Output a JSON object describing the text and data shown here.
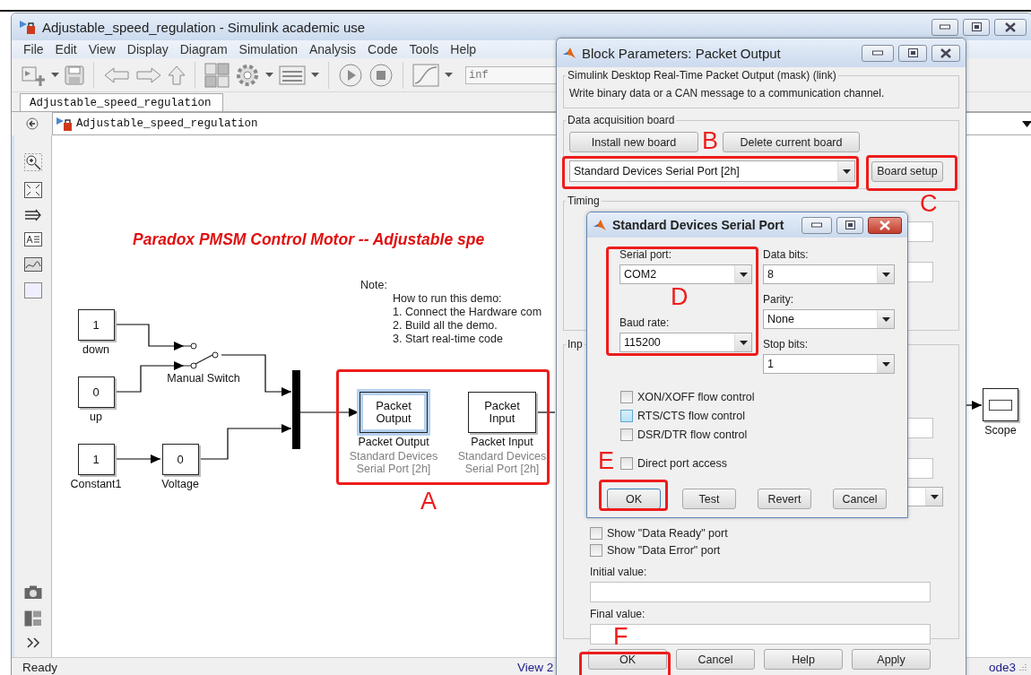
{
  "window": {
    "title": "Adjustable_speed_regulation - Simulink academic use"
  },
  "menu": [
    "File",
    "Edit",
    "View",
    "Display",
    "Diagram",
    "Simulation",
    "Analysis",
    "Code",
    "Tools",
    "Help"
  ],
  "toolbar": {
    "stop_time": "inf"
  },
  "tabs": [
    {
      "label": "Adjustable_speed_regulation",
      "selected": true
    }
  ],
  "breadcrumb": {
    "label": "Adjustable_speed_regulation"
  },
  "diagram": {
    "title": "Paradox PMSM Control Motor  -- Adjustable spe",
    "note": {
      "heading": "Note:",
      "lines": [
        "How to run this demo:",
        "1.  Connect the Hardware com",
        "2.  Build all the demo.",
        "3.  Start real-time code"
      ]
    },
    "blocks": [
      {
        "kind": "constant",
        "value": "1",
        "label": "down"
      },
      {
        "kind": "switch",
        "label": "Manual Switch"
      },
      {
        "kind": "constant",
        "value": "0",
        "label": "up"
      },
      {
        "kind": "mux"
      },
      {
        "kind": "packet",
        "text": "Packet Output",
        "label": "Packet Output",
        "detail": "Standard Devices Serial Port [2h]",
        "selected": true
      },
      {
        "kind": "packet",
        "text": "Packet Input",
        "label": "Packet Input",
        "detail": "Standard Devices Serial Port [2h]",
        "selected": false
      },
      {
        "kind": "scope",
        "label": "Scope"
      },
      {
        "kind": "constant",
        "value": "1",
        "label": "Constant1"
      },
      {
        "kind": "constant",
        "value": "0",
        "label": "Voltage"
      }
    ]
  },
  "status_bar": {
    "state": "Ready",
    "view": "View 2",
    "solver": "ode3"
  },
  "block_parameters": {
    "title": "Block Parameters: Packet Output",
    "mask": {
      "legend": "Simulink Desktop Real-Time Packet Output (mask) (link)",
      "description": "Write binary data or a CAN message to a communication channel."
    },
    "board": {
      "legend": "Data acquisition board",
      "buttons": [
        "Install new board",
        "Delete current board"
      ],
      "selected_board": "Standard Devices Serial Port [2h]",
      "setup_button": "Board setup"
    },
    "timing": {
      "legend": "Timing"
    },
    "input": {
      "legend": "Inp",
      "checkboxes": [
        {
          "label": "Show \"Data Ready\" port",
          "checked": false
        },
        {
          "label": "Show \"Data Error\" port",
          "checked": false
        }
      ],
      "fields": [
        {
          "label": "Initial value:"
        },
        {
          "label": "Final value:"
        }
      ]
    },
    "buttons": [
      "OK",
      "Cancel",
      "Help",
      "Apply"
    ]
  },
  "serial_port_dialog": {
    "title": "Standard Devices Serial Port",
    "left_fields": [
      {
        "label": "Serial port:",
        "value": "COM2"
      },
      {
        "label": "Baud rate:",
        "value": "115200"
      }
    ],
    "right_fields": [
      {
        "label": "Data bits:",
        "value": "8"
      },
      {
        "label": "Parity:",
        "value": "None"
      },
      {
        "label": "Stop bits:",
        "value": "1"
      }
    ],
    "checkboxes": [
      {
        "label": "XON/XOFF flow control",
        "checked": false,
        "hovered": false
      },
      {
        "label": "RTS/CTS flow control",
        "checked": false,
        "hovered": true
      },
      {
        "label": "DSR/DTR flow control",
        "checked": false,
        "hovered": false
      }
    ],
    "direct_access": {
      "label": "Direct port access",
      "checked": false
    },
    "buttons": [
      {
        "label": "OK",
        "focused": true
      },
      {
        "label": "Test",
        "focused": false
      },
      {
        "label": "Revert",
        "focused": false
      },
      {
        "label": "Cancel",
        "focused": false
      }
    ]
  },
  "annotations": [
    {
      "label": "A"
    },
    {
      "label": "B"
    },
    {
      "label": "C"
    },
    {
      "label": "D"
    },
    {
      "label": "E"
    },
    {
      "label": "F"
    }
  ]
}
